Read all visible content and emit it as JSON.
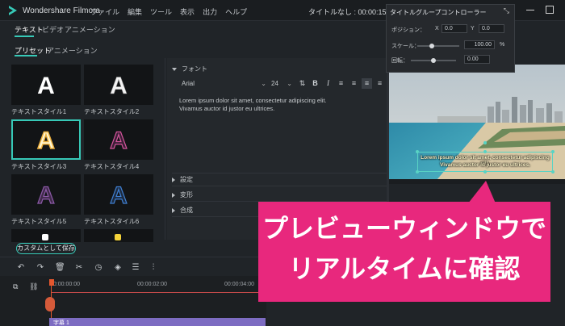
{
  "app": {
    "name": "Wondershare Filmora",
    "menu": [
      "ファイル",
      "編集",
      "ツール",
      "表示",
      "出力",
      "ヘルプ"
    ],
    "doc_title": "タイトルなし : 00:00:15:01"
  },
  "tabs": [
    "テキスト",
    "ビデオ",
    "アニメーション"
  ],
  "sub_tabs": [
    "プリセット",
    "アニメーション"
  ],
  "styles": [
    {
      "label": "テキストスタイル1",
      "glyph": "A"
    },
    {
      "label": "テキストスタイル2",
      "glyph": "A"
    },
    {
      "label": "テキストスタイル3",
      "glyph": "A"
    },
    {
      "label": "テキストスタイル4",
      "glyph": "A"
    },
    {
      "label": "テキストスタイル5",
      "glyph": "A"
    },
    {
      "label": "テキストスタイル6",
      "glyph": "A"
    }
  ],
  "font_panel": {
    "section_font": "フォント",
    "font_name": "Arial",
    "font_size": "24",
    "text_line1": "Lorem ipsum dolor sit amet, consectetur adipiscing elit.",
    "text_line2": "Vivamus auctor id justor eu ultrices.",
    "section_settings": "設定",
    "section_transform": "変形",
    "section_composite": "合成"
  },
  "float_panel": {
    "title": "タイトルグループコントローラー",
    "position_label": "ポジション：",
    "x_label": "X",
    "x_value": "0.0",
    "y_label": "Y",
    "y_value": "0.0",
    "scale_label": "スケール：",
    "scale_value": "100.00",
    "scale_unit": "%",
    "scale_level": 0.35,
    "rotate_label": "回転：",
    "rotate_value": "0.00",
    "rotate_level": 0.5
  },
  "preview": {
    "line1": "Lorem ipsum dolor sit amet, consectetur adipiscing elit.",
    "line2": "Vivamus auctor id justor eu ultrices."
  },
  "callout": {
    "line1": "プレビューウィンドウで",
    "line2": "リアルタイムに確認",
    "color": "#e8287d"
  },
  "bottom": {
    "custom_save": "カスタムとして保存",
    "ruler": [
      "00:00:00:00",
      "00:00:02:00",
      "00:00:04:00"
    ],
    "clip_label": "字幕 1"
  },
  "accent": "#37c9b7"
}
